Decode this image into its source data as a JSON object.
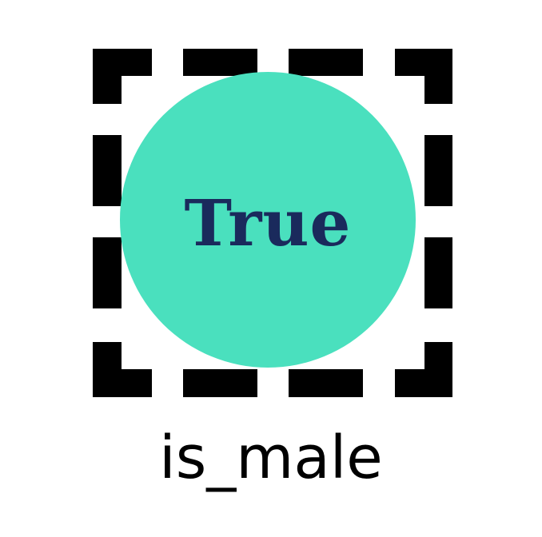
{
  "variable": {
    "name": "is_male",
    "value": "True"
  },
  "colors": {
    "value_circle": "#4ae0be",
    "value_text": "#1a2a5c",
    "frame": "#000000"
  }
}
